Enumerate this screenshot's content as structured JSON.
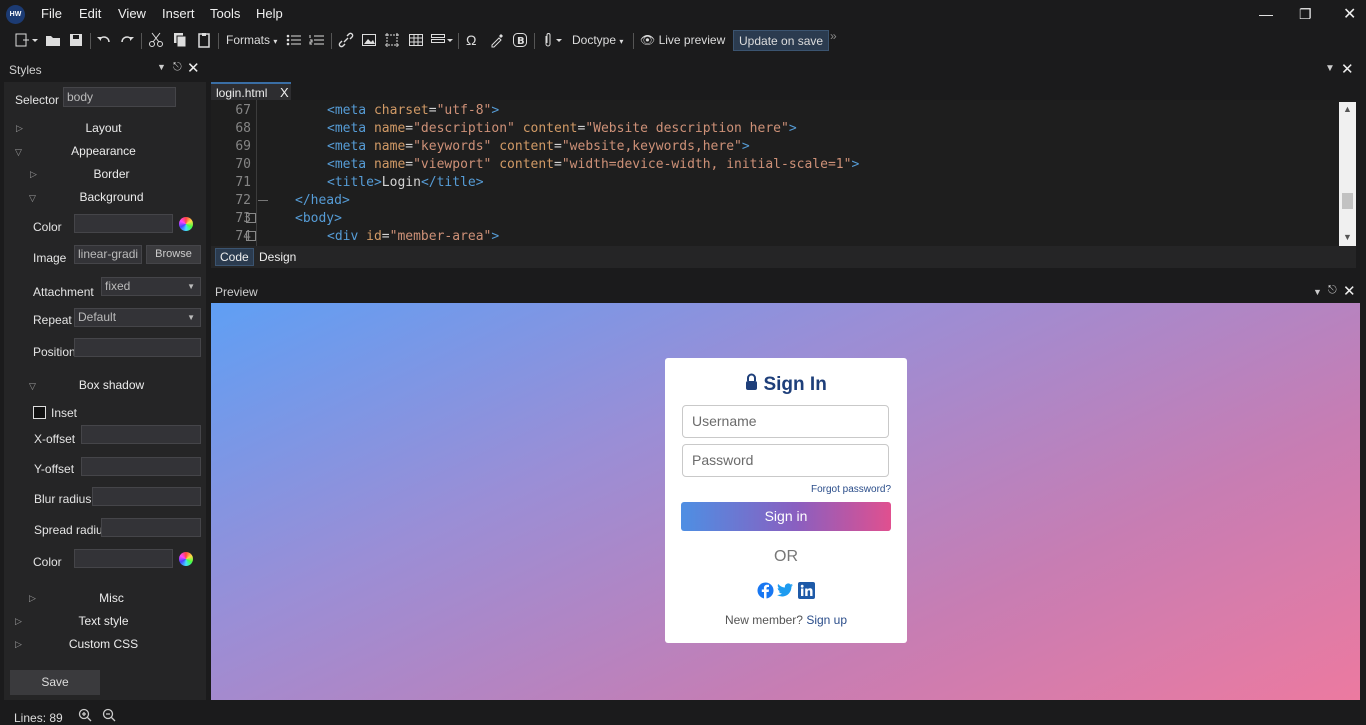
{
  "menu": {
    "logo": "HW",
    "items": [
      "File",
      "Edit",
      "View",
      "Insert",
      "Tools",
      "Help"
    ]
  },
  "toolbar": {
    "formats": "Formats",
    "doctype": "Doctype",
    "live_preview": "Live preview",
    "update_on_save": "Update on save"
  },
  "styles_panel": {
    "title": "Styles",
    "selector_label": "Selector",
    "selector_value": "body",
    "layout": "Layout",
    "appearance": "Appearance",
    "border": "Border",
    "background": "Background",
    "color_label": "Color",
    "image_label": "Image",
    "image_value": "linear-gradi",
    "browse": "Browse",
    "attachment_label": "Attachment",
    "attachment_value": "fixed",
    "repeat_label": "Repeat",
    "repeat_value": "Default",
    "position_label": "Position",
    "box_shadow": "Box shadow",
    "inset": "Inset",
    "x_offset": "X-offset",
    "y_offset": "Y-offset",
    "blur_radius": "Blur radius",
    "spread_radius": "Spread radius",
    "color2_label": "Color",
    "misc": "Misc",
    "text_style": "Text style",
    "custom_css": "Custom CSS",
    "save": "Save"
  },
  "editor": {
    "tab": "login.html",
    "tab_close": "X",
    "lines": [
      "67",
      "68",
      "69",
      "70",
      "71",
      "72",
      "73",
      "74"
    ],
    "view_tabs": [
      "Code",
      "Design"
    ]
  },
  "preview": {
    "title": "Preview",
    "card": {
      "heading": "Sign In",
      "username_placeholder": "Username",
      "password_placeholder": "Password",
      "forgot": "Forgot password?",
      "sign_in": "Sign in",
      "or": "OR",
      "new_member": "New member?",
      "sign_up": "Sign up"
    }
  },
  "status": {
    "lines": "Lines: 89"
  }
}
